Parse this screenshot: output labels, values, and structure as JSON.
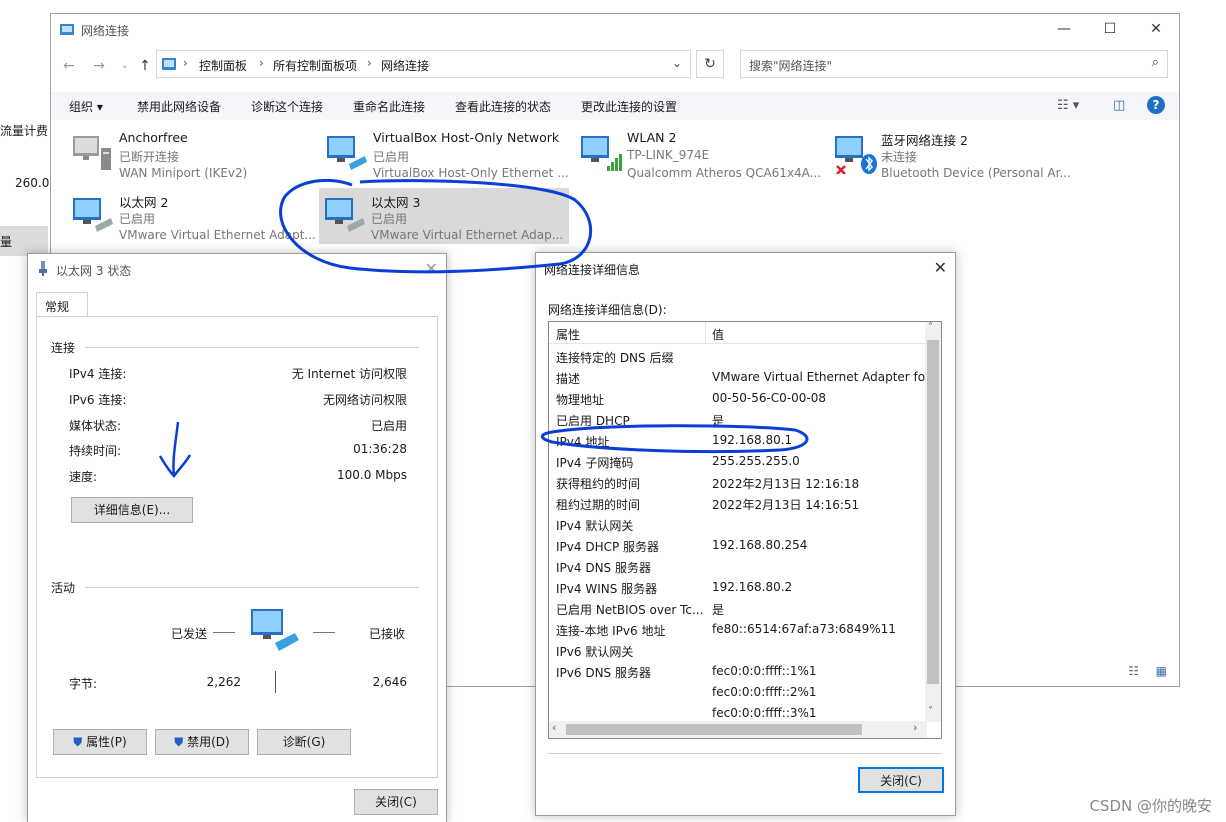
{
  "background": {
    "fragment1": "流量计费",
    "fragment2": "260.0",
    "fragment3": "量"
  },
  "explorer": {
    "title": "网络连接",
    "breadcrumbs": [
      "控制面板",
      "所有控制面板项",
      "网络连接"
    ],
    "search_placeholder": "搜索\"网络连接\"",
    "commands": [
      "组织 ▾",
      "禁用此网络设备",
      "诊断这个连接",
      "重命名此连接",
      "查看此连接的状态",
      "更改此连接的设置"
    ],
    "items": [
      {
        "name": "Anchorfree",
        "status": "已断开连接",
        "device": "WAN Miniport (IKEv2)"
      },
      {
        "name": "VirtualBox Host-Only Network",
        "status": "已启用",
        "device": "VirtualBox Host-Only Ethernet ..."
      },
      {
        "name": "WLAN 2",
        "status": "TP-LINK_974E",
        "device": "Qualcomm Atheros QCA61x4A..."
      },
      {
        "name": "蓝牙网络连接 2",
        "status": "未连接",
        "device": "Bluetooth Device (Personal Ar..."
      },
      {
        "name": "以太网 2",
        "status": "已启用",
        "device": "VMware Virtual Ethernet Adapt..."
      },
      {
        "name": "以太网 3",
        "status": "已启用",
        "device": "VMware Virtual Ethernet Adap..."
      }
    ]
  },
  "status_dialog": {
    "title": "以太网 3 状态",
    "tab": "常规",
    "section_connection": "连接",
    "rows": [
      {
        "label": "IPv4 连接:",
        "value": "无 Internet 访问权限"
      },
      {
        "label": "IPv6 连接:",
        "value": "无网络访问权限"
      },
      {
        "label": "媒体状态:",
        "value": "已启用"
      },
      {
        "label": "持续时间:",
        "value": "01:36:28"
      },
      {
        "label": "速度:",
        "value": "100.0 Mbps"
      }
    ],
    "details_button": "详细信息(E)...",
    "section_activity": "活动",
    "sent_label": "已发送",
    "received_label": "已接收",
    "bytes_label": "字节:",
    "bytes_sent": "2,262",
    "bytes_received": "2,646",
    "properties_button": "属性(P)",
    "disable_button": "禁用(D)",
    "diagnose_button": "诊断(G)",
    "close_button": "关闭(C)"
  },
  "details_dialog": {
    "title": "网络连接详细信息",
    "caption": "网络连接详细信息(D):",
    "col_property": "属性",
    "col_value": "值",
    "rows": [
      {
        "p": "连接特定的 DNS 后缀",
        "v": ""
      },
      {
        "p": "描述",
        "v": "VMware Virtual Ethernet Adapter for"
      },
      {
        "p": "物理地址",
        "v": "00-50-56-C0-00-08"
      },
      {
        "p": "已启用 DHCP",
        "v": "是"
      },
      {
        "p": "IPv4 地址",
        "v": "192.168.80.1"
      },
      {
        "p": "IPv4 子网掩码",
        "v": "255.255.255.0"
      },
      {
        "p": "获得租约的时间",
        "v": "2022年2月13日 12:16:18"
      },
      {
        "p": "租约过期的时间",
        "v": "2022年2月13日 14:16:51"
      },
      {
        "p": "IPv4 默认网关",
        "v": ""
      },
      {
        "p": "IPv4 DHCP 服务器",
        "v": "192.168.80.254"
      },
      {
        "p": "IPv4 DNS 服务器",
        "v": ""
      },
      {
        "p": "IPv4 WINS 服务器",
        "v": "192.168.80.2"
      },
      {
        "p": "已启用 NetBIOS over Tc...",
        "v": "是"
      },
      {
        "p": "连接-本地 IPv6 地址",
        "v": "fe80::6514:67af:a73:6849%11"
      },
      {
        "p": "IPv6 默认网关",
        "v": ""
      },
      {
        "p": "IPv6 DNS 服务器",
        "v": "fec0:0:0:ffff::1%1"
      },
      {
        "p": "",
        "v": "fec0:0:0:ffff::2%1"
      },
      {
        "p": "",
        "v": "fec0:0:0:ffff::3%1"
      }
    ],
    "close_button": "关闭(C)"
  },
  "watermark": "CSDN @你的晚安",
  "colors": {
    "accent": "#0078d7",
    "annotation": "#0a3fd6"
  }
}
